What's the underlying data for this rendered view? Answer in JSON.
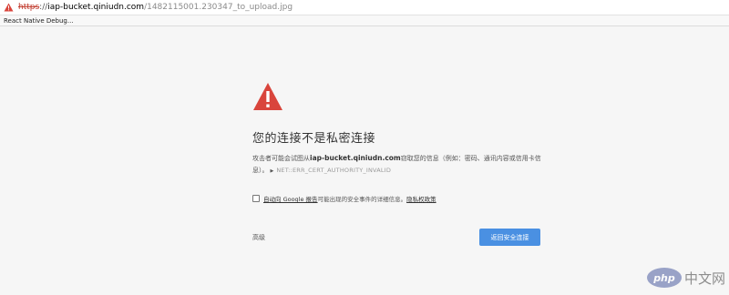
{
  "browser": {
    "url": {
      "scheme": "https",
      "separator": "://",
      "host": "iap-bucket.qiniudn.com",
      "path": "/1482115001.230347_to_upload.jpg"
    },
    "bookmarks": [
      {
        "label": "React Native Debug..."
      }
    ]
  },
  "interstitial": {
    "title": "您的连接不是私密连接",
    "explanation_prefix": "攻击者可能会试图从",
    "domain": "iap-bucket.qiniudn.com",
    "explanation_suffix": "窃取您的信息（例如：密码、通讯内容或信用卡信息）。",
    "error_code": "NET::ERR_CERT_AUTHORITY_INVALID",
    "report_link": "自动向 Google 报告",
    "report_text": "可能出现的安全事件的详细信息。",
    "privacy_link": "隐私权政策",
    "advanced_label": "高级",
    "back_button_label": "返回安全连接"
  },
  "watermark": {
    "badge": "php",
    "text": "中文网"
  },
  "colors": {
    "warning_red": "#d9453c",
    "button_blue": "#4a90e2",
    "background": "#f6f6f6"
  },
  "icons": {
    "url_warning": "warning-triangle-small",
    "main_warning": "warning-triangle"
  }
}
